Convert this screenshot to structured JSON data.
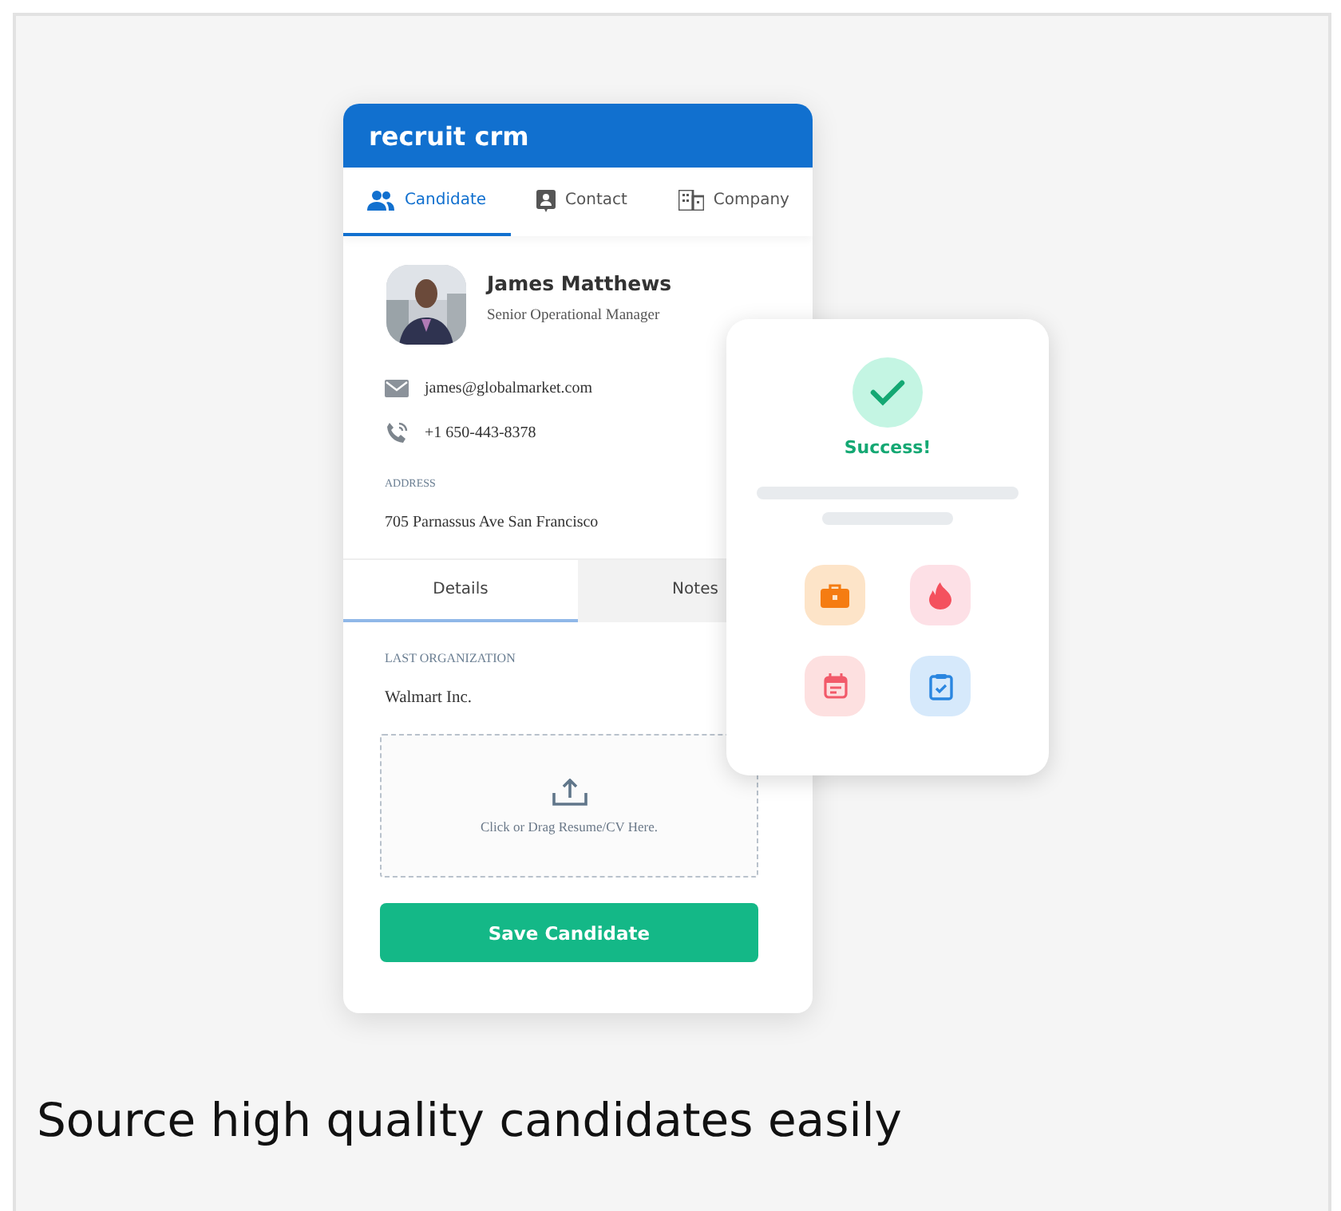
{
  "brand": "recruit crm",
  "tabs": [
    {
      "label": "Candidate",
      "kind": "people",
      "selected": true
    },
    {
      "label": "Contact",
      "kind": "contact",
      "selected": false
    },
    {
      "label": "Company",
      "kind": "building",
      "selected": false
    }
  ],
  "profile": {
    "name": "James Matthews",
    "title": "Senior Operational Manager"
  },
  "contacts": [
    {
      "kind": "email",
      "value": "james@globalmarket.com"
    },
    {
      "kind": "phone",
      "value": "+1 650-443-8378"
    }
  ],
  "address": {
    "label": "ADDRESS",
    "value": "705 Parnassus Ave San Francisco"
  },
  "detail_tabs": [
    {
      "label": "Details",
      "selected": true
    },
    {
      "label": "Notes",
      "selected": false
    }
  ],
  "last_organization": {
    "label": "LAST ORGANIZATION",
    "value": "Walmart Inc."
  },
  "upload": {
    "text": "Click or Drag Resume/CV Here."
  },
  "save_button": "Save Candidate",
  "success_card": {
    "message": "Success!",
    "tiles": [
      {
        "kind": "briefcase",
        "color": "#fde4c8"
      },
      {
        "kind": "flame",
        "color": "#fde0e6"
      },
      {
        "kind": "calendar",
        "color": "#fde0e0"
      },
      {
        "kind": "clipboard",
        "color": "#d6e9fb"
      }
    ]
  },
  "caption": "Source high quality candidates easily"
}
